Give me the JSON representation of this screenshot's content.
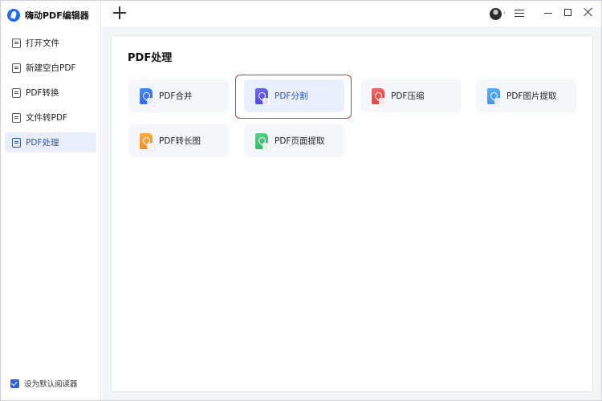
{
  "app": {
    "name": "嗨动PDF编辑器"
  },
  "sidebar": {
    "items": [
      {
        "label": "打开文件",
        "icon": "file-open-icon",
        "active": false
      },
      {
        "label": "新建空白PDF",
        "icon": "image-file-icon",
        "active": false
      },
      {
        "label": "PDF转换",
        "icon": "pdf-convert-icon",
        "active": false
      },
      {
        "label": "文件转PDF",
        "icon": "file-to-pdf-icon",
        "active": false
      },
      {
        "label": "PDF处理",
        "icon": "pdf-process-icon",
        "active": true
      }
    ],
    "default_reader": {
      "label": "设为默认阅读器",
      "checked": true
    }
  },
  "topbar": {
    "add_tab_icon": "plus-icon",
    "avatar_caret": "·",
    "menu_icon": "hamburger-icon",
    "window_controls": [
      "minimize-icon",
      "maximize-icon",
      "close-icon"
    ]
  },
  "main": {
    "title": "PDF处理",
    "tools": [
      {
        "label": "PDF合并",
        "color": "#2f63e0",
        "selected": false
      },
      {
        "label": "PDF分割",
        "color": "#4a44d8",
        "selected": true
      },
      {
        "label": "PDF压缩",
        "color": "#e43d3d",
        "selected": false
      },
      {
        "label": "PDF图片提取",
        "color": "#3b8fe8",
        "selected": false
      },
      {
        "label": "PDF转长图",
        "color": "#f08a1f",
        "selected": false
      },
      {
        "label": "PDF页面提取",
        "color": "#2fb567",
        "selected": false
      }
    ],
    "highlight_color": "#d23a2a"
  }
}
